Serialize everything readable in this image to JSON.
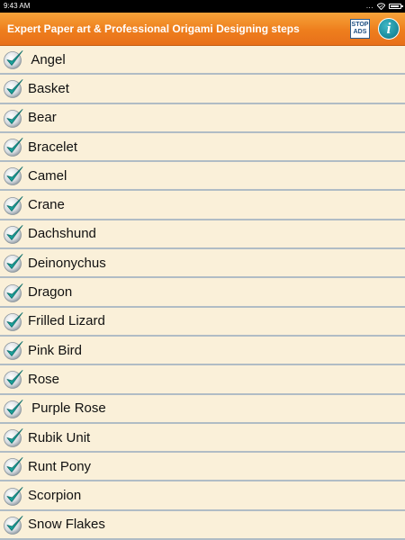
{
  "status_bar": {
    "time": "9:43 AM",
    "dots": "..."
  },
  "app_bar": {
    "title": "Expert Paper art & Professional Origami Designing steps",
    "stop_ads_line1": "STOP",
    "stop_ads_line2": "ADS",
    "info_glyph": "i"
  },
  "items": [
    {
      "label": " Angel"
    },
    {
      "label": "Basket"
    },
    {
      "label": "Bear"
    },
    {
      "label": "Bracelet"
    },
    {
      "label": "Camel"
    },
    {
      "label": "Crane"
    },
    {
      "label": "Dachshund"
    },
    {
      "label": "Deinonychus"
    },
    {
      "label": "Dragon"
    },
    {
      "label": "Frilled Lizard"
    },
    {
      "label": "Pink Bird"
    },
    {
      "label": "Rose"
    },
    {
      "label": " Purple Rose"
    },
    {
      "label": "Rubik Unit"
    },
    {
      "label": "Runt Pony"
    },
    {
      "label": "Scorpion"
    },
    {
      "label": "Snow Flakes"
    }
  ],
  "icons": {
    "list_item": "checkmark-icon",
    "info": "info-icon",
    "stop_ads": "stop-ads-icon"
  },
  "colors": {
    "accent": "#ee7e1d",
    "background": "#faf0d9",
    "check": "#1aa09a"
  }
}
